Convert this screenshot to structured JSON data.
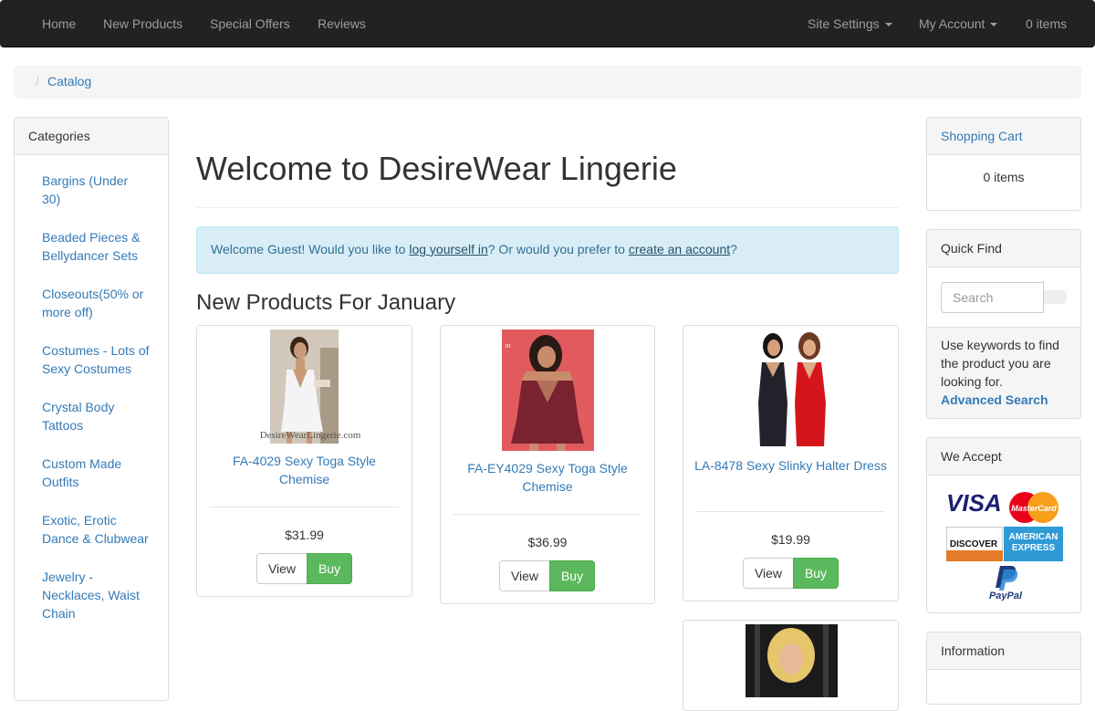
{
  "navbar": {
    "items": [
      "Home",
      "New Products",
      "Special Offers",
      "Reviews"
    ],
    "site_settings": "Site Settings",
    "my_account": "My Account",
    "cart_items": "0 items"
  },
  "breadcrumb": {
    "separator": "/",
    "current": "Catalog"
  },
  "categories": {
    "heading": "Categories",
    "items": [
      "Bargins (Under 30)",
      "Beaded Pieces & Bellydancer Sets",
      "Closeouts(50% or more off)",
      "Costumes - Lots of Sexy Costumes",
      "Crystal Body Tattoos",
      "Custom Made Outfits",
      "Exotic, Erotic Dance & Clubwear",
      "Jewelry - Necklaces, Waist Chain"
    ]
  },
  "main": {
    "title": "Welcome to DesireWear Lingerie",
    "alert": {
      "prefix": "Welcome Guest! Would you like to ",
      "login_link": "log yourself in",
      "middle": "? Or would you prefer to ",
      "create_link": "create an account",
      "suffix": "?"
    },
    "new_products_title": "New Products For January",
    "products": [
      {
        "name": "FA-4029 Sexy Toga Style Chemise",
        "price": "$31.99",
        "watermark": "DesireWearLingerie.com"
      },
      {
        "name": "FA-EY4029 Sexy Toga Style Chemise",
        "price": "$36.99"
      },
      {
        "name": "LA-8478 Sexy Slinky Halter Dress",
        "price": "$19.99"
      }
    ],
    "view_label": "View",
    "buy_label": "Buy"
  },
  "cart": {
    "heading": "Shopping Cart",
    "items": "0 items"
  },
  "quick_find": {
    "heading": "Quick Find",
    "placeholder": "Search",
    "help": "Use keywords to find the product you are looking for.",
    "advanced": "Advanced Search"
  },
  "we_accept": {
    "heading": "We Accept",
    "cards": [
      "VISA",
      "MasterCard",
      "DISCOVER",
      "AMERICAN EXPRESS",
      "PayPal"
    ]
  },
  "information": {
    "heading": "Information"
  },
  "colors": {
    "navbar_bg": "#222222",
    "link": "#337ab7",
    "buy_green": "#5cb85c",
    "alert_bg": "#d9edf7"
  }
}
